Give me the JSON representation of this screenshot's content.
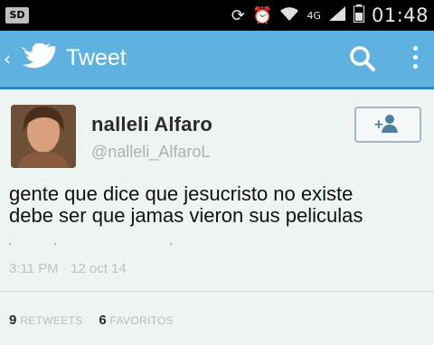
{
  "status_bar": {
    "time": "01:48",
    "icons": [
      "sim-icon",
      "sync-icon",
      "alarm-icon",
      "wifi-icon",
      "data-icon",
      "signal-icon",
      "battery-icon"
    ]
  },
  "app_bar": {
    "title": "Tweet",
    "accent": "#5fb2e0"
  },
  "tweet": {
    "author_name": "nalleli  Alfaro",
    "author_handle": "@nalleli_AlfaroL",
    "text_line1": "gente que dice que jesucristo no existe",
    "text_line2": "debe ser que jamas vieron sus peliculas",
    "timestamp": "3:11 PM · 12 oct 14",
    "retweets_count": "9",
    "retweets_label": "RETWEETS",
    "favorites_count": "6",
    "favorites_label": "FAVORITOS"
  }
}
